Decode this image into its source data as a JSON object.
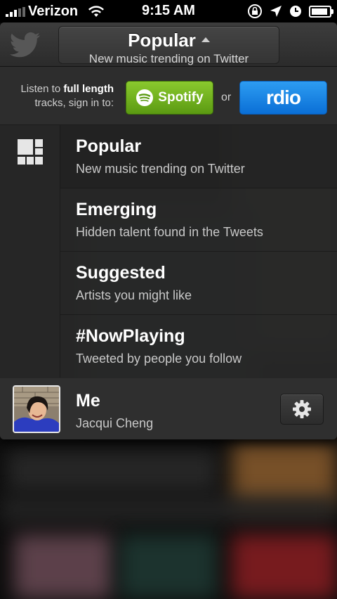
{
  "status_bar": {
    "carrier": "Verizon",
    "time": "9:15 AM",
    "battery_level": 0.9
  },
  "header": {
    "title": "Popular",
    "subtitle": "New music trending on Twitter",
    "left_icon": "twitter-bird-icon",
    "title_icon": "caret-up-icon"
  },
  "signin": {
    "prefix": "Listen to ",
    "bold": "full length",
    "suffix": "tracks, sign in to:",
    "spotify_label": "Spotify",
    "or_label": "or",
    "rdio_label": "rdio",
    "spotify_color": "#6fb31d",
    "rdio_color": "#1787e6"
  },
  "menu": {
    "side_icon": "grid-icon",
    "items": [
      {
        "title": "Popular",
        "subtitle": "New music trending on Twitter"
      },
      {
        "title": "Emerging",
        "subtitle": "Hidden talent found in the Tweets"
      },
      {
        "title": "Suggested",
        "subtitle": "Artists you might like"
      },
      {
        "title": "#NowPlaying",
        "subtitle": "Tweeted by people you follow"
      }
    ]
  },
  "me": {
    "title": "Me",
    "name": "Jacqui Cheng",
    "settings_icon": "gear-icon"
  }
}
